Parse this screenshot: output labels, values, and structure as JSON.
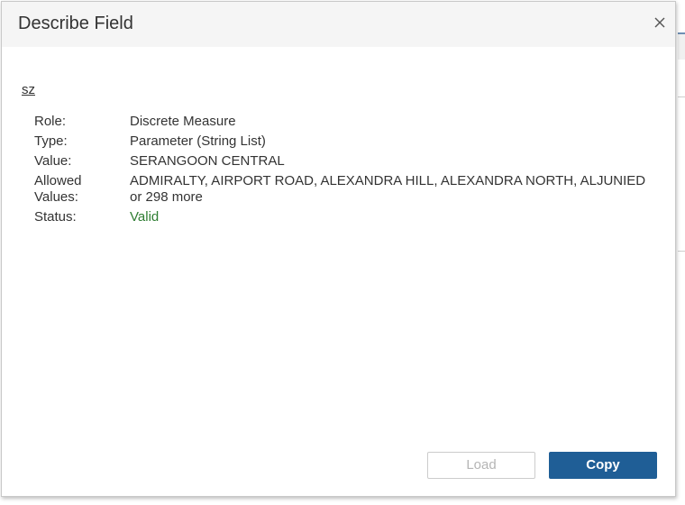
{
  "dialog": {
    "title": "Describe Field",
    "close_icon": "close-icon"
  },
  "field": {
    "name": "sz",
    "properties": [
      {
        "label": "Role:",
        "value": "Discrete Measure"
      },
      {
        "label": "Type:",
        "value": "Parameter (String List)"
      },
      {
        "label": "Value:",
        "value": "SERANGOON CENTRAL"
      },
      {
        "label": "Allowed\nValues:",
        "value": "ADMIRALTY, AIRPORT ROAD, ALEXANDRA HILL, ALEXANDRA NORTH, ALJUNIED\nor 298 more"
      },
      {
        "label": "Status:",
        "value": "Valid"
      }
    ]
  },
  "buttons": {
    "load_label": "Load",
    "copy_label": "Copy"
  },
  "colors": {
    "accent": "#1f5e96",
    "valid": "#2e7d32"
  }
}
